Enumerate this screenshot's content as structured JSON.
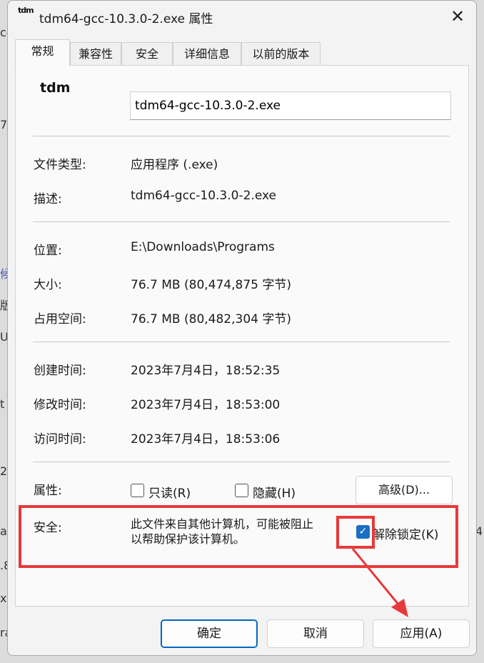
{
  "window": {
    "title": "tdm64-gcc-10.3.0-2.exe 属性",
    "icon_text": "tdm",
    "close_label": "✕"
  },
  "tabs": [
    {
      "label": "常规",
      "active": true
    },
    {
      "label": "兼容性"
    },
    {
      "label": "安全"
    },
    {
      "label": "详细信息"
    },
    {
      "label": "以前的版本"
    }
  ],
  "general": {
    "app_icon_text": "tdm",
    "filename": "tdm64-gcc-10.3.0-2.exe",
    "file_type_label": "文件类型:",
    "file_type_value": "应用程序 (.exe)",
    "description_label": "描述:",
    "description_value": "tdm64-gcc-10.3.0-2.exe",
    "location_label": "位置:",
    "location_value": "E:\\Downloads\\Programs",
    "size_label": "大小:",
    "size_value": "76.7 MB (80,474,875 字节)",
    "size_on_disk_label": "占用空间:",
    "size_on_disk_value": "76.7 MB (80,482,304 字节)",
    "created_label": "创建时间:",
    "created_value": "2023年7月4日，18:52:35",
    "modified_label": "修改时间:",
    "modified_value": "2023年7月4日，18:53:00",
    "accessed_label": "访问时间:",
    "accessed_value": "2023年7月4日，18:53:06",
    "attributes_label": "属性:",
    "readonly_label": "只读(R)",
    "readonly_checked": false,
    "hidden_label": "隐藏(H)",
    "hidden_checked": false,
    "advanced_button": "高级(D)...",
    "security_label": "安全:",
    "security_text_1": "此文件来自其他计算机，可能被阻止",
    "security_text_2": "以帮助保护该计算机。",
    "unblock_label": "解除锁定(K)",
    "unblock_checked": true
  },
  "footer": {
    "ok": "确定",
    "cancel": "取消",
    "apply": "应用(A)"
  },
  "colors": {
    "highlight": "#e8393a",
    "accent": "#0067c0"
  }
}
